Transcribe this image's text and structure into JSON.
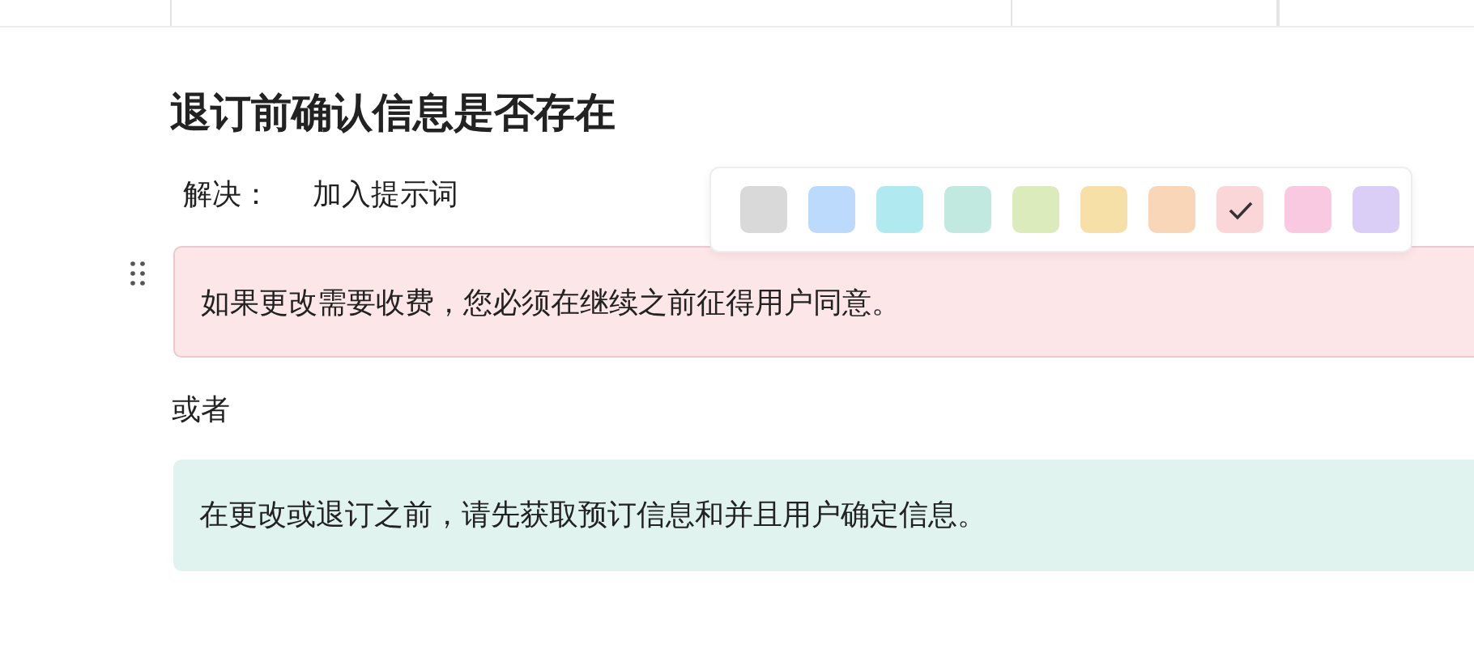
{
  "heading": "退订前确认信息是否存在",
  "solution": {
    "label": "解决：",
    "value": "加入提示词"
  },
  "color_palette": [
    {
      "color": "#d9d9d9",
      "selected": false
    },
    {
      "color": "#bcdafc",
      "selected": false
    },
    {
      "color": "#b0e9f0",
      "selected": false
    },
    {
      "color": "#c2e9df",
      "selected": false
    },
    {
      "color": "#dcebbc",
      "selected": false
    },
    {
      "color": "#f7e0a8",
      "selected": false
    },
    {
      "color": "#f9d6b8",
      "selected": false
    },
    {
      "color": "#fbd6d8",
      "selected": true
    },
    {
      "color": "#f9c9e2",
      "selected": false
    },
    {
      "color": "#dacdf6",
      "selected": false
    }
  ],
  "callouts": [
    {
      "text": "如果更改需要收费，您必须在继续之前征得用户同意。",
      "color": "#fce6e8"
    },
    {
      "text": "在更改或退订之前，请先获取预订信息和并且用户确定信息。",
      "color": "#e0f3ee"
    }
  ],
  "separator_text": "或者"
}
